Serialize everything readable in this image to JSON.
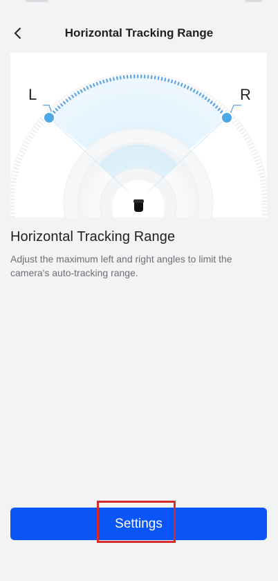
{
  "header": {
    "title": "Horizontal Tracking Range",
    "back_icon": "chevron-left-icon"
  },
  "illustration": {
    "left_label": "L",
    "right_label": "R",
    "accent_color": "#4f9fe6",
    "camera_icon": "camera-icon"
  },
  "content": {
    "section_title": "Horizontal Tracking Range",
    "description": "Adjust the maximum left and right angles to limit the camera's auto-tracking range."
  },
  "actions": {
    "settings_label": "Settings"
  },
  "colors": {
    "primary_button": "#0a55f5",
    "background": "#f2f3f5",
    "highlight_border": "#d52b2b"
  }
}
